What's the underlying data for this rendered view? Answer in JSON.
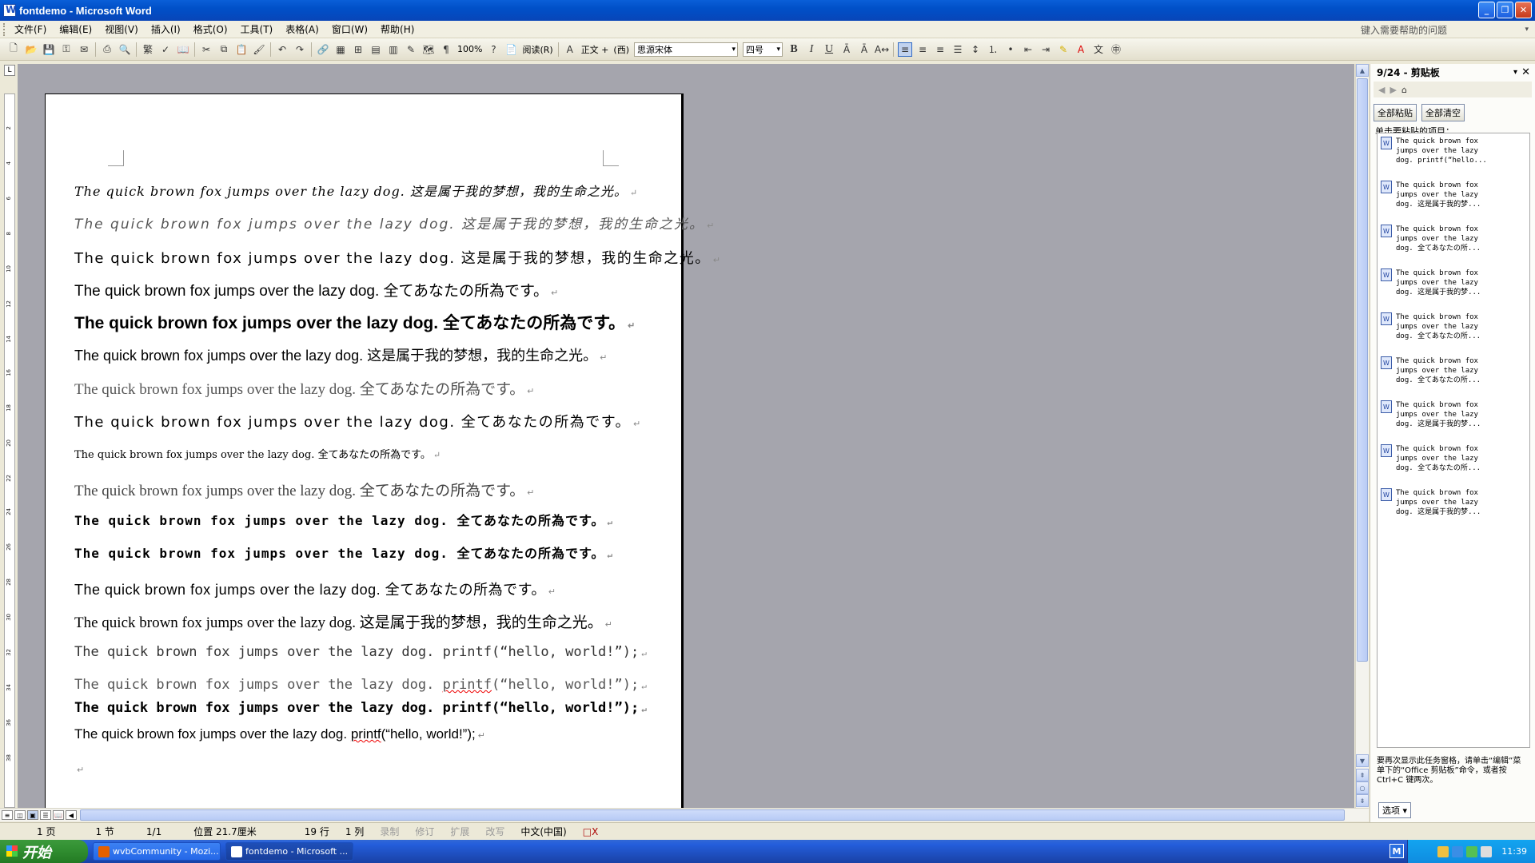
{
  "window": {
    "title": "fontdemo - Microsoft Word",
    "controls": [
      "_",
      "❐",
      "✕"
    ]
  },
  "menubar": {
    "items": [
      "文件(F)",
      "编辑(E)",
      "视图(V)",
      "插入(I)",
      "格式(O)",
      "工具(T)",
      "表格(A)",
      "窗口(W)",
      "帮助(H)"
    ],
    "help_placeholder": "键入需要帮助的问题"
  },
  "toolbar": {
    "zoom": "100%",
    "read_label": "阅读(R)",
    "style": "正文 +",
    "western": "(西)",
    "font": "思源宋体",
    "size": "四号",
    "bold": "B",
    "italic": "I",
    "underline": "U"
  },
  "ruler": {
    "ticks": [
      "8",
      "6",
      "4",
      "2",
      "",
      "2",
      "4",
      "6",
      "8",
      "10",
      "12",
      "14",
      "16",
      "18",
      "20",
      "22",
      "24",
      "26",
      "28",
      "30",
      "32",
      "34",
      "36",
      "38",
      "40",
      "42",
      "44",
      "46",
      "48"
    ],
    "vticks": [
      "2",
      "4",
      "6",
      "8",
      "10",
      "12",
      "14",
      "16",
      "18",
      "20",
      "22",
      "24",
      "26",
      "28",
      "30",
      "32",
      "34",
      "36",
      "38"
    ]
  },
  "document": {
    "lines": [
      "The quick brown fox jumps over the lazy dog. 这是属于我的梦想，我的生命之光。",
      "The quick brown fox jumps over the lazy dog. 这是属于我的梦想，我的生命之光。",
      "The quick brown fox jumps over the lazy dog. 这是属于我的梦想，我的生命之光。",
      "The quick brown fox jumps over the lazy dog. 全てあなたの所為です。",
      "The quick brown fox jumps over the lazy dog. 全てあなたの所為です。",
      "The quick brown fox jumps over the lazy dog. 这是属于我的梦想，我的生命之光。",
      "The quick brown fox jumps over the lazy dog. 全てあなたの所為です。",
      "The quick brown fox jumps over the lazy dog. 全てあなたの所為です。",
      "The quick brown fox jumps over the lazy dog. 全てあなたの所為です。",
      "The quick brown fox jumps over the lazy dog. 全てあなたの所為です。",
      "The quick brown fox jumps over the lazy dog. 全てあなたの所為です。",
      "The quick brown fox jumps over the lazy dog. 全てあなたの所為です。",
      "The quick brown fox jumps over the lazy dog. 全てあなたの所為です。",
      "The quick brown fox jumps over the lazy dog. 这是属于我的梦想，我的生命之光。"
    ],
    "code_lines": [
      {
        "text": "The quick brown fox jumps over the lazy dog. ",
        "code": "printf",
        "rest": "(“hello, world!”);"
      },
      {
        "text": "The quick brown fox jumps over the lazy dog. ",
        "code": "printf",
        "rest": "(“hello, world!”);"
      },
      {
        "text": "The quick brown fox jumps over the lazy dog. ",
        "code": "printf",
        "rest": "(“hello, world!”);"
      },
      {
        "text": "The quick brown fox jumps over the lazy dog. ",
        "code": "printf",
        "rest": "(“hello, world!”);"
      }
    ],
    "paragraph_mark": "↵"
  },
  "taskpane": {
    "title": "9/24 - 剪贴板",
    "paste_all": "全部粘贴",
    "clear_all": "全部清空",
    "hint": "单击要粘贴的项目：",
    "items": [
      "The quick brown fox\njumps over the lazy\ndog. printf(“hello...",
      "The quick brown fox\njumps over the lazy\ndog. 这是属于我的梦...",
      "The quick brown fox\njumps over the lazy\ndog. 全てあなたの所...",
      "The quick brown fox\njumps over the lazy\ndog. 这是属于我的梦...",
      "The quick brown fox\njumps over the lazy\ndog. 全てあなたの所...",
      "The quick brown fox\njumps over the lazy\ndog. 全てあなたの所...",
      "The quick brown fox\njumps over the lazy\ndog. 这是属于我的梦...",
      "The quick brown fox\njumps over the lazy\ndog. 全てあなたの所...",
      "The quick brown fox\njumps over the lazy\ndog. 这是属于我的梦..."
    ],
    "footer": "要再次显示此任务窗格，请单击“编辑”菜单下的“Office 剪贴板”命令，或者按 Ctrl+C 键两次。",
    "options": "选项 ▾"
  },
  "statusbar": {
    "page": "1 页",
    "section": "1 节",
    "pages": "1/1",
    "position": "位置 21.7厘米",
    "line": "19 行",
    "column": "1 列",
    "rec": "录制",
    "trk": "修订",
    "ext": "扩展",
    "ovr": "改写",
    "lang": "中文(中国)",
    "spell": "□X"
  },
  "taskbar": {
    "start": "开始",
    "tasks": [
      "wvbCommunity - Mozi...",
      "fontdemo - Microsoft ..."
    ],
    "ime": "M",
    "clock": "11:39"
  },
  "colors": {
    "titlebar": "#0050c8",
    "doc_gray": "#a5a5ad"
  }
}
